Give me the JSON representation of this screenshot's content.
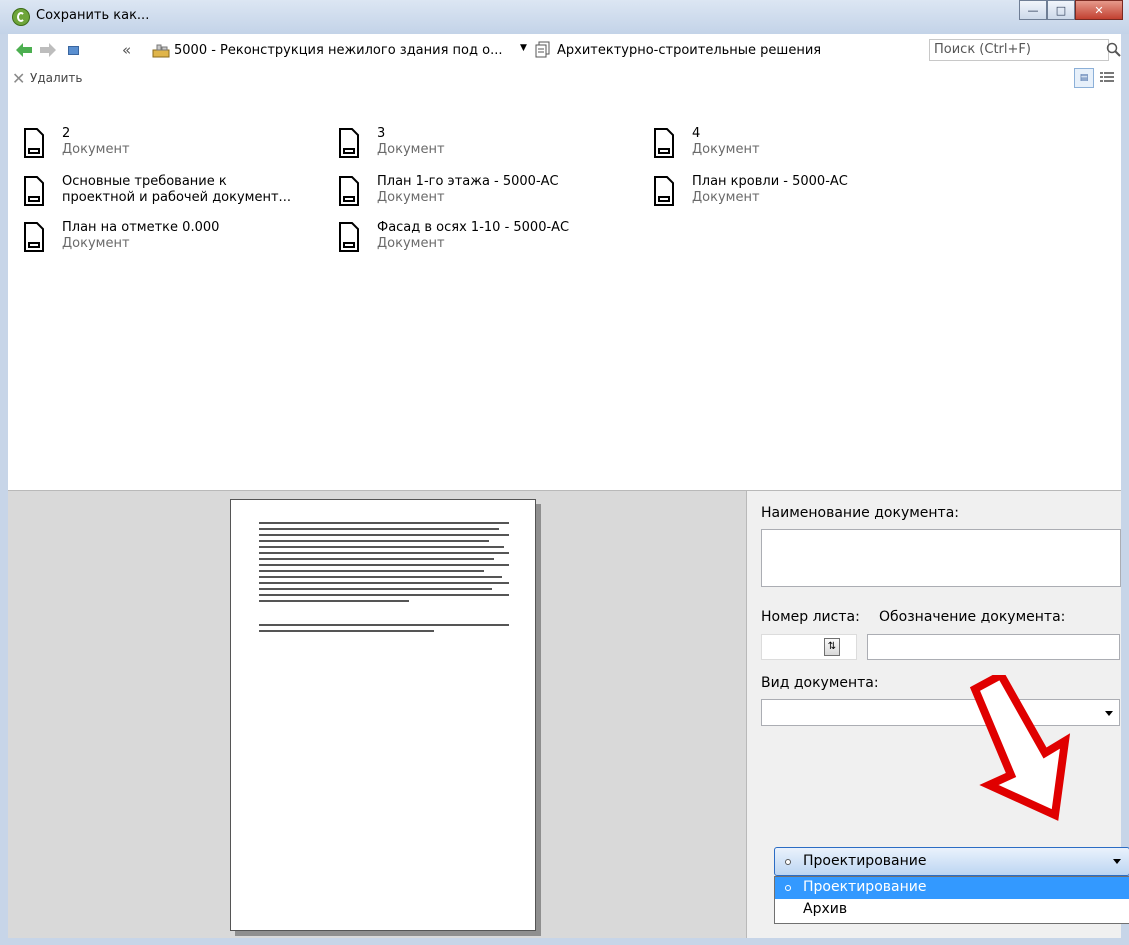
{
  "window": {
    "title": "Сохранить как..."
  },
  "nav": {
    "path_project": "5000 - Реконструкция нежилого здания под о...",
    "path_folder": "Архитектурно-строительные решения",
    "search_placeholder": "Поиск (Ctrl+F)"
  },
  "toolbar": {
    "delete_label": "Удалить"
  },
  "files": [
    {
      "name": "2",
      "type": "Документ"
    },
    {
      "name": "3",
      "type": "Документ"
    },
    {
      "name": "4",
      "type": "Документ"
    },
    {
      "name_line1": "Основные требование к",
      "name_line2": "проектной и рабочей документ...",
      "type": "Документ"
    },
    {
      "name": "План 1-го этажа - 5000-АС",
      "type": "Документ"
    },
    {
      "name": "План кровли - 5000-АС",
      "type": "Документ"
    },
    {
      "name": "План на отметке 0.000",
      "type": "Документ"
    },
    {
      "name": "Фасад в осях 1-10 - 5000-АС",
      "type": "Документ"
    }
  ],
  "form": {
    "doc_name_label": "Наименование документа:",
    "sheet_number_label": "Номер листа:",
    "doc_designation_label": "Обозначение документа:",
    "doc_type_label": "Вид документа:",
    "doc_type_value": "",
    "stage_selected": "Проектирование",
    "stage_options": [
      "Проектирование",
      "Архив"
    ]
  }
}
